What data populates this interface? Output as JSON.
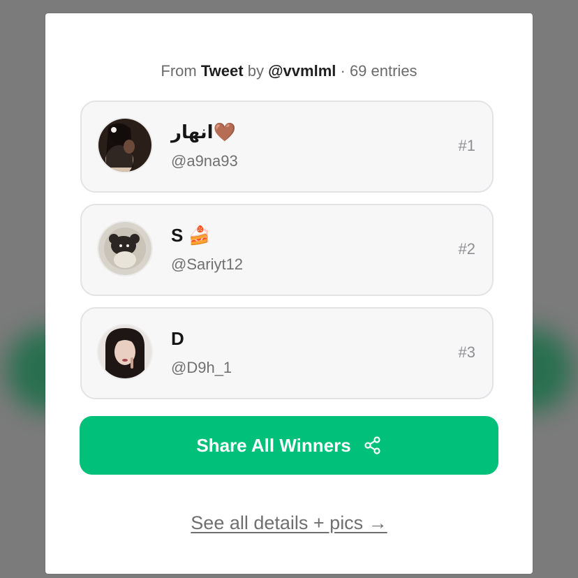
{
  "header": {
    "from_label": "From",
    "source": "Tweet",
    "by_label": "by",
    "author": "@vvmlml",
    "entries": "· 69 entries"
  },
  "winners": [
    {
      "name": "انهار🤎",
      "handle": "@a9na93",
      "rank": "#1"
    },
    {
      "name": "S 🍰",
      "handle": "@Sariyt12",
      "rank": "#2"
    },
    {
      "name": "D",
      "handle": "@D9h_1",
      "rank": "#3"
    }
  ],
  "share_button": {
    "label": "Share All Winners",
    "icon": "share-icon"
  },
  "details_link": {
    "label": "See all details + pics →"
  },
  "colors": {
    "accent": "#00c07a",
    "backdrop": "#7b7b7b",
    "card_bg": "#f7f7f8"
  }
}
